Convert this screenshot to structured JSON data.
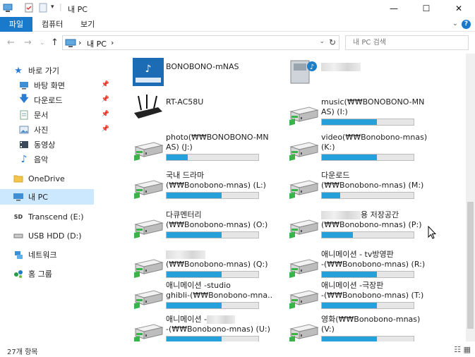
{
  "window": {
    "title": "내 PC",
    "minimize": "—",
    "maximize": "☐",
    "close": "✕"
  },
  "ribbon": {
    "tabs": [
      {
        "label": "파일"
      },
      {
        "label": "컴퓨터"
      },
      {
        "label": "보기"
      }
    ],
    "help": "?"
  },
  "address": {
    "crumb_root": "내 PC",
    "separator": "›",
    "dropdown": "⌄",
    "refresh": "↻",
    "search_placeholder": "내 PC 검색"
  },
  "nav": {
    "quick_access": "바로 가기",
    "items": [
      {
        "label": "바탕 화면",
        "icon": "desktop-icon",
        "pinned": true
      },
      {
        "label": "다운로드",
        "icon": "download-icon",
        "pinned": true
      },
      {
        "label": "문서",
        "icon": "document-icon",
        "pinned": true
      },
      {
        "label": "사진",
        "icon": "picture-icon",
        "pinned": true
      },
      {
        "label": "동영상",
        "icon": "video-icon",
        "pinned": false
      },
      {
        "label": "음악",
        "icon": "music-icon",
        "pinned": false
      }
    ],
    "onedrive": "OneDrive",
    "this_pc": "내 PC",
    "transcend": "Transcend (E:)",
    "usb": "USB HDD (D:)",
    "network": "네트워크",
    "homegroup": "홈 그룹"
  },
  "content": {
    "items": [
      {
        "line1": "BONOBONO-mNAS",
        "line2": "",
        "type": "nas",
        "fill": null
      },
      {
        "line1": "",
        "line2": "",
        "type": "media",
        "fill": null,
        "redacted": true
      },
      {
        "line1": "RT-AC58U",
        "line2": "",
        "type": "router",
        "fill": null
      },
      {
        "line1": "music(₩₩BONOBONO-MN",
        "line2": "AS) (I:)",
        "type": "drive",
        "fill": 0.6
      },
      {
        "line1": "photo(₩₩BONOBONO-MN",
        "line2": "AS) (J:)",
        "type": "drive",
        "fill": 0.23
      },
      {
        "line1": "video(₩₩Bonobono-mnas)",
        "line2": "(K:)",
        "type": "drive",
        "fill": 0.6
      },
      {
        "line1": "국내 드라마",
        "line2": "(₩₩Bonobono-mnas) (L:)",
        "type": "drive",
        "fill": 0.6
      },
      {
        "line1": "다운로드",
        "line2": "(₩₩Bonobono-mnas) (M:)",
        "type": "drive",
        "fill": 0.2
      },
      {
        "line1": "다큐멘터리",
        "line2": "(₩₩Bonobono-mnas) (O:)",
        "type": "drive",
        "fill": 0.6
      },
      {
        "line1": "용 저장공간",
        "line2": "(₩₩Bonobono-mnas) (P:)",
        "type": "drive",
        "fill": 0.34,
        "redact_prefix": true
      },
      {
        "line1": "",
        "line2": "(₩₩Bonobono-mnas) (Q:)",
        "type": "drive",
        "fill": 0.6,
        "redact_prefix": true
      },
      {
        "line1": "애니메이션 - tv방영판",
        "line2": "-(₩₩Bonobono-mnas) (R:)",
        "type": "drive",
        "fill": 0.6
      },
      {
        "line1": "애니메이션 -studio",
        "line2": "ghibli-(₩₩Bonobono-mna...",
        "type": "drive",
        "fill": 0.6
      },
      {
        "line1": "애니메이션 -극장판",
        "line2": "-(₩₩Bonobono-mnas) (T:)",
        "type": "drive",
        "fill": 0.6
      },
      {
        "line1": "애니메이션 -",
        "line2": "-(₩₩Bonobono-mnas) (U:)",
        "type": "drive",
        "fill": 0.6,
        "redact_suffix": true
      },
      {
        "line1": "영화(₩₩Bonobono-mnas)",
        "line2": "(V:)",
        "type": "drive",
        "fill": 0.6
      }
    ]
  },
  "status": {
    "count": "27개 항목"
  },
  "colors": {
    "accent": "#1979ca",
    "selection": "#cce8ff",
    "bar_fill": "#26a0da",
    "bar_bg": "#e6e6e6"
  }
}
